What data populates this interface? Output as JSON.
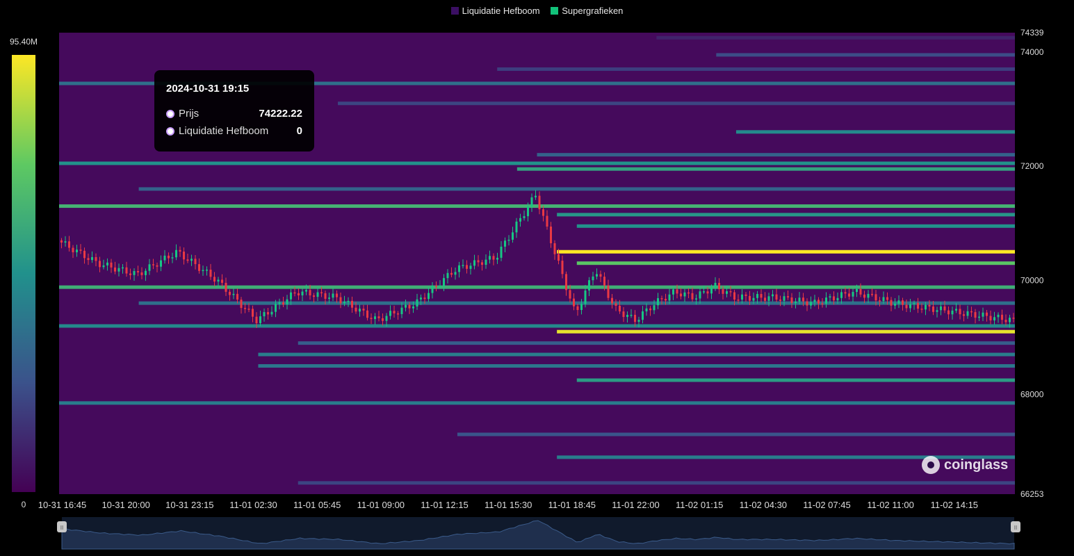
{
  "legend": {
    "items": [
      {
        "label": "Liquidatie Hefboom",
        "color": "#3b0f63"
      },
      {
        "label": "Supergrafieken",
        "color": "#12c27a"
      }
    ]
  },
  "colorbar": {
    "max_label": "95.40M",
    "min_label": "0"
  },
  "tooltip": {
    "title": "2024-10-31 19:15",
    "rows": [
      {
        "label": "Prijs",
        "value": "74222.22"
      },
      {
        "label": "Liquidatie Hefboom",
        "value": "0"
      }
    ]
  },
  "watermark": {
    "text": "coinglass",
    "icon": "coinglass-logo-icon"
  },
  "navigator": {
    "left_handle": "II",
    "right_handle": "II"
  },
  "chart_data": {
    "type": "heatmap",
    "title": "",
    "xlabel": "",
    "ylabel": "",
    "ylim": [
      66253,
      74339
    ],
    "y_tick_labels": [
      "74339",
      "74000",
      "72000",
      "70000",
      "68000",
      "66253"
    ],
    "y_ticks": [
      74339,
      74000,
      72000,
      70000,
      68000,
      66253
    ],
    "x_tick_labels": [
      "10-31 16:45",
      "10-31 20:00",
      "10-31 23:15",
      "11-01 02:30",
      "11-01 05:45",
      "11-01 09:00",
      "11-01 12:15",
      "11-01 15:30",
      "11-01 18:45",
      "11-01 22:00",
      "11-02 01:15",
      "11-02 04:30",
      "11-02 07:45",
      "11-02 11:00",
      "11-02 14:15"
    ],
    "colorscale": [
      "#440154",
      "#3b528b",
      "#21918c",
      "#5ec962",
      "#fde725"
    ],
    "value_range": [
      0,
      95.4
    ],
    "value_unit": "M",
    "price_series_x_hours": [
      0,
      2,
      4,
      6,
      8,
      10,
      12,
      14,
      16,
      18,
      20,
      22,
      24,
      26,
      27,
      28,
      29,
      30,
      31,
      32,
      33,
      34,
      36,
      38,
      40,
      42,
      44,
      46,
      48
    ],
    "price_series": [
      70700,
      70300,
      70100,
      70500,
      70000,
      69300,
      69800,
      69700,
      69300,
      69600,
      70200,
      70400,
      71500,
      69400,
      70200,
      69500,
      69300,
      69600,
      69800,
      69700,
      69900,
      69700,
      69700,
      69600,
      69800,
      69600,
      69500,
      69400,
      69300
    ],
    "liquidation_bands": [
      {
        "price": 74250,
        "start_h": 30,
        "value": 10
      },
      {
        "price": 73950,
        "start_h": 33,
        "value": 22
      },
      {
        "price": 73700,
        "start_h": 22,
        "value": 18
      },
      {
        "price": 73450,
        "start_h": 0,
        "value": 35
      },
      {
        "price": 73100,
        "start_h": 14,
        "value": 20
      },
      {
        "price": 72600,
        "start_h": 34,
        "value": 45
      },
      {
        "price": 72200,
        "start_h": 24,
        "value": 30
      },
      {
        "price": 72050,
        "start_h": 0,
        "value": 48
      },
      {
        "price": 71950,
        "start_h": 23,
        "value": 55
      },
      {
        "price": 71600,
        "start_h": 4,
        "value": 30
      },
      {
        "price": 71300,
        "start_h": 0,
        "value": 62
      },
      {
        "price": 71150,
        "start_h": 25,
        "value": 50
      },
      {
        "price": 70950,
        "start_h": 26,
        "value": 48
      },
      {
        "price": 70500,
        "start_h": 25,
        "value": 95.4
      },
      {
        "price": 70300,
        "start_h": 26,
        "value": 70
      },
      {
        "price": 69880,
        "start_h": 0,
        "value": 60
      },
      {
        "price": 69600,
        "start_h": 4,
        "value": 35
      },
      {
        "price": 69200,
        "start_h": 0,
        "value": 45
      },
      {
        "price": 69100,
        "start_h": 25,
        "value": 92
      },
      {
        "price": 68900,
        "start_h": 12,
        "value": 28
      },
      {
        "price": 68700,
        "start_h": 10,
        "value": 40
      },
      {
        "price": 68500,
        "start_h": 10,
        "value": 38
      },
      {
        "price": 68250,
        "start_h": 26,
        "value": 52
      },
      {
        "price": 67850,
        "start_h": 0,
        "value": 40
      },
      {
        "price": 67300,
        "start_h": 20,
        "value": 25
      },
      {
        "price": 66900,
        "start_h": 25,
        "value": 40
      },
      {
        "price": 66450,
        "start_h": 12,
        "value": 20
      }
    ]
  }
}
